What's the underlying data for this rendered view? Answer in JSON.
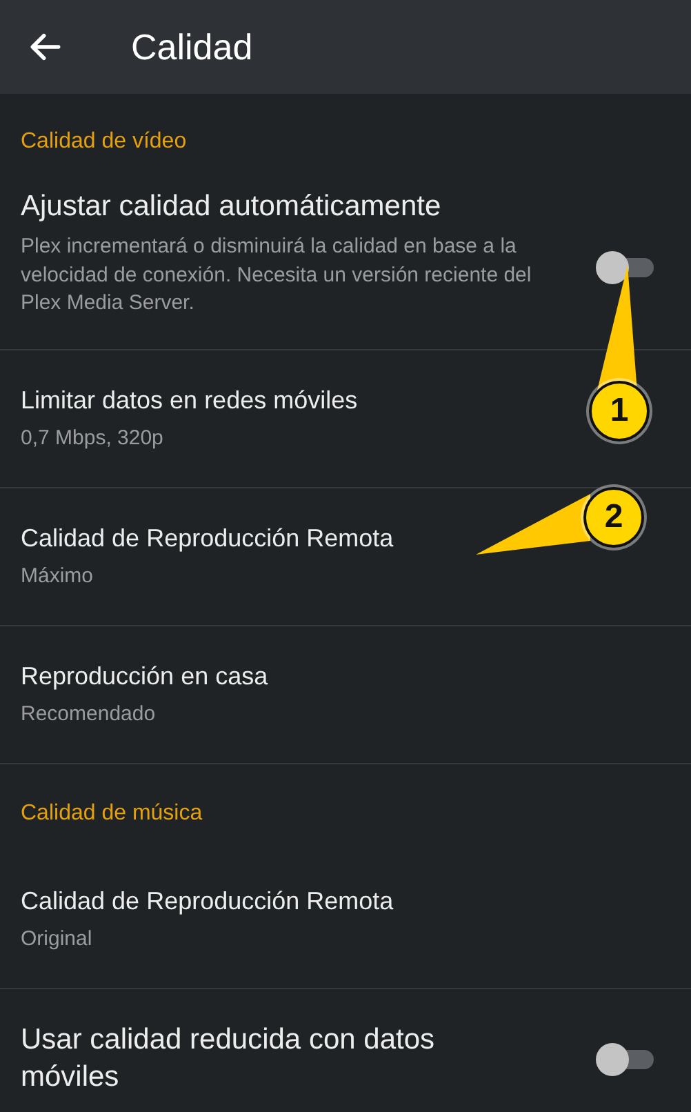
{
  "header": {
    "title": "Calidad"
  },
  "sections": [
    {
      "title": "Calidad de vídeo",
      "items": [
        {
          "kind": "toggle",
          "title": "Ajustar calidad automáticamente",
          "subtitle": "Plex incrementará o disminuirá la calidad en base a la velocidad de conexión. Necesita un versión reciente del Plex Media Server.",
          "on": false
        },
        {
          "kind": "nav",
          "title": "Limitar datos en redes móviles",
          "subtitle": "0,7 Mbps, 320p"
        },
        {
          "kind": "nav",
          "title": "Calidad de Reproducción Remota",
          "subtitle": "Máximo"
        },
        {
          "kind": "nav",
          "title": "Reproducción en casa",
          "subtitle": "Recomendado"
        }
      ]
    },
    {
      "title": "Calidad de música",
      "items": [
        {
          "kind": "nav",
          "title": "Calidad de Reproducción Remota",
          "subtitle": "Original"
        },
        {
          "kind": "toggle",
          "title": "Usar calidad reducida con datos móviles",
          "on": false
        }
      ]
    }
  ],
  "annotations": [
    {
      "label": "1"
    },
    {
      "label": "2"
    }
  ]
}
